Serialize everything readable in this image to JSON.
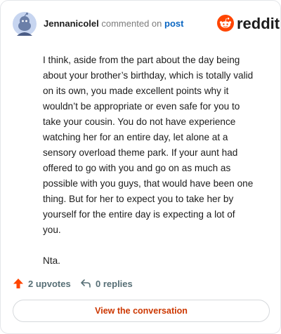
{
  "header": {
    "username": "Jennanicolel",
    "action_text": "commented on",
    "post_link": "post",
    "brand": "reddit"
  },
  "comment": {
    "paragraphs": [
      "I think, aside from the part about the day being about your brother’s birthday, which is totally valid on its own, you made excellent points why it wouldn’t be appropriate or even safe for you to take your cousin. You do not have experience watching her for an entire day, let alone at a sensory overload theme park. If your aunt had offered to go with you and go on as much as possible with you guys, that would have been one thing. But for her to expect you to take her by yourself for the entire day is expecting a lot of you.",
      "Nta."
    ]
  },
  "footer": {
    "upvotes": "2 upvotes",
    "replies": "0 replies"
  },
  "cta": {
    "label": "View the conversation"
  },
  "colors": {
    "brand_orange": "#ff4500",
    "link_blue": "#0a66c2",
    "cta_text": "#cc3700",
    "muted": "#576f76"
  },
  "icons": [
    "snoo-avatar-icon",
    "reddit-logo-icon",
    "upvote-arrow-icon",
    "reply-arrow-icon"
  ]
}
